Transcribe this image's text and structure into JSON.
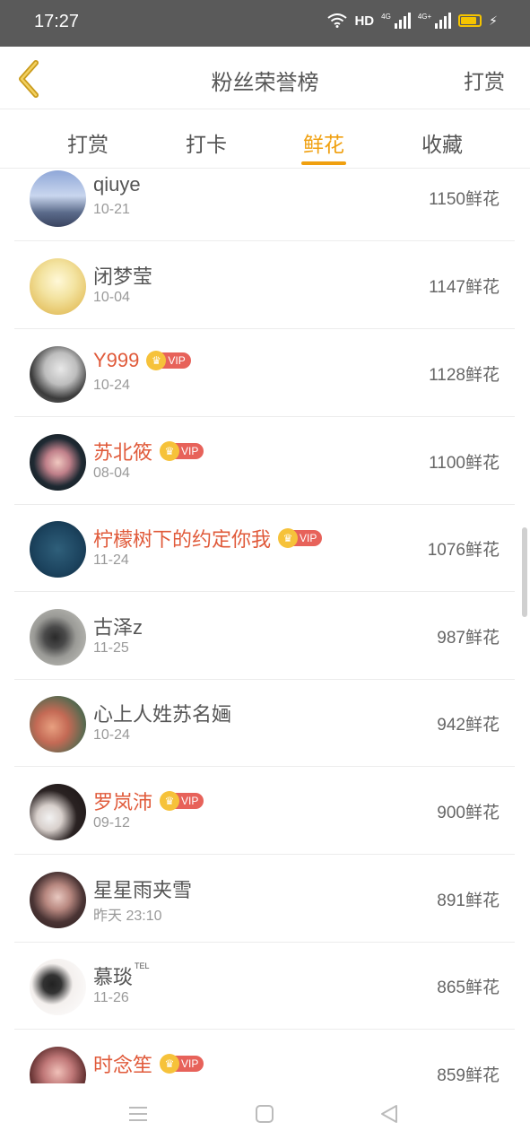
{
  "status_bar": {
    "time": "17:27",
    "hd_label": "HD",
    "network_label": "4G",
    "network_label_2": "4G+"
  },
  "header": {
    "title": "粉丝荣誉榜",
    "action_label": "打赏",
    "back_icon": "chevron-left-icon",
    "accent_color": "#f0a010"
  },
  "tabs": [
    {
      "label": "打赏",
      "active": false
    },
    {
      "label": "打卡",
      "active": false
    },
    {
      "label": "鲜花",
      "active": true
    },
    {
      "label": "收藏",
      "active": false
    }
  ],
  "vip_label": "VIP",
  "rows": [
    {
      "name": "qiuye",
      "date": "10-21",
      "count": "1150鲜花",
      "vip": false
    },
    {
      "name": "闭梦莹",
      "date": "10-04",
      "count": "1147鲜花",
      "vip": false
    },
    {
      "name": "Y999",
      "date": "10-24",
      "count": "1128鲜花",
      "vip": true
    },
    {
      "name": "苏北筱",
      "date": "08-04",
      "count": "1100鲜花",
      "vip": true
    },
    {
      "name": "柠檬树下的约定你我",
      "date": "11-24",
      "count": "1076鲜花",
      "vip": true
    },
    {
      "name": "古泽z",
      "date": "11-25",
      "count": "987鲜花",
      "vip": false
    },
    {
      "name": "心上人姓苏名婳",
      "date": "10-24",
      "count": "942鲜花",
      "vip": false
    },
    {
      "name": "罗岚沛",
      "date": "09-12",
      "count": "900鲜花",
      "vip": true
    },
    {
      "name": "星星雨夹雪",
      "date": "昨天 23:10",
      "count": "891鲜花",
      "vip": false
    },
    {
      "name": "慕琰",
      "name_sup": "TEL",
      "date": "11-26",
      "count": "865鲜花",
      "vip": false
    },
    {
      "name": "时念笙",
      "date": "",
      "count": "859鲜花",
      "vip": true
    }
  ],
  "nav": {
    "menu_icon": "menu-icon",
    "home_icon": "home-square-icon",
    "back_icon": "back-triangle-icon"
  }
}
